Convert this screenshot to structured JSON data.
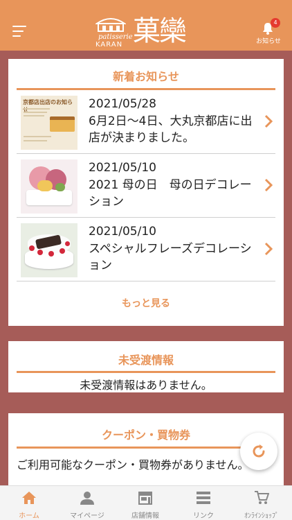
{
  "header": {
    "logo_patisserie": "patisserie",
    "logo_name": "KARAN",
    "logo_kanji": "菓欒",
    "notification_label": "お知らせ",
    "notification_count": "4",
    "accent_color": "#e8955a"
  },
  "news": {
    "title": "新着お知らせ",
    "items": [
      {
        "date": "2021/05/28",
        "title": "6月2日～4日、大丸京都店に出店が決まりました。",
        "thumb_caption": "京都店出店のお知らせ"
      },
      {
        "date": "2021/05/10",
        "title": "2021 母の日　母の日デコレーション",
        "thumb_caption": ""
      },
      {
        "date": "2021/05/10",
        "title": "スペシャルフレーズデコレーション",
        "thumb_caption": ""
      }
    ],
    "more_label": "もっと見る"
  },
  "undelivered": {
    "title": "未受渡情報",
    "message": "未受渡情報はありません。"
  },
  "coupon": {
    "title": "クーポン・買物券",
    "message": "ご利用可能なクーポン・買物券がありません。"
  },
  "tabs": [
    {
      "label": "ホーム",
      "icon": "home-icon"
    },
    {
      "label": "マイページ",
      "icon": "person-icon"
    },
    {
      "label": "店舗情報",
      "icon": "store-icon"
    },
    {
      "label": "リンク",
      "icon": "list-icon"
    },
    {
      "label": "ｵﾝﾗｲﾝｼｮｯﾌﾟ",
      "icon": "cart-icon"
    }
  ]
}
